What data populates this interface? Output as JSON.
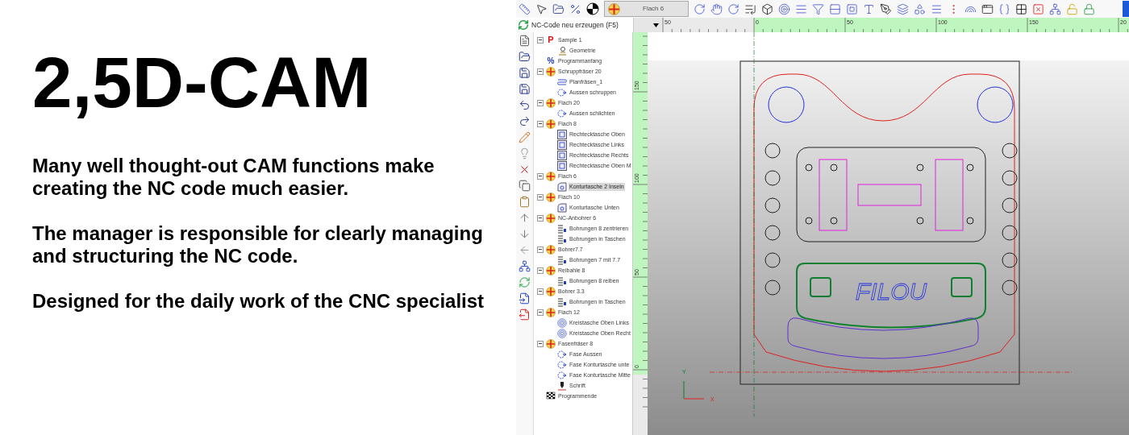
{
  "hero": {
    "title": "2,5D-CAM",
    "paragraphs": [
      "Many well thought-out CAM functions make creating the NC code much easier.",
      "The manager is responsible for clearly managing and structuring the NC code.",
      "Designed for the daily work of the CNC specialist"
    ]
  },
  "toolbar": {
    "combo": {
      "value": "Flach 6"
    }
  },
  "command": {
    "label": "NC-Code neu erzeugen (F5)"
  },
  "h_ruler": {
    "labels": [
      "50",
      "0",
      "50",
      "100",
      "150",
      "20"
    ]
  },
  "v_ruler": {
    "labels": [
      "150",
      "100",
      "50",
      "0"
    ]
  },
  "tree": [
    {
      "label": "Sample 1",
      "kind": "program",
      "glyph": "P",
      "selected": false,
      "expanded": true,
      "children": [
        {
          "label": "Geometrie",
          "kind": "geometry",
          "selected": false
        }
      ]
    },
    {
      "label": "Programmanfang",
      "kind": "start",
      "glyph": "%",
      "selected": false
    },
    {
      "label": "Schruppfräser 20",
      "kind": "tool",
      "selected": false,
      "expanded": true,
      "children": [
        {
          "label": "Planfräsen_1",
          "kind": "face",
          "selected": false
        },
        {
          "label": "Aussen schruppen",
          "kind": "contour",
          "selected": false
        }
      ]
    },
    {
      "label": "Flach 20",
      "kind": "tool",
      "selected": false,
      "expanded": true,
      "children": [
        {
          "label": "Aussen schlichten",
          "kind": "contour",
          "selected": false
        }
      ]
    },
    {
      "label": "Flach 8",
      "kind": "tool",
      "selected": false,
      "expanded": true,
      "children": [
        {
          "label": "Rechtecktasche Oben",
          "kind": "pocket",
          "selected": false
        },
        {
          "label": "Rechtecktasche Links",
          "kind": "pocket",
          "selected": false
        },
        {
          "label": "Rechtecktasche Rechts",
          "kind": "pocket",
          "selected": false
        },
        {
          "label": "Rechtecktasche Oben M",
          "kind": "pocket",
          "selected": false
        }
      ]
    },
    {
      "label": "Flach 6",
      "kind": "tool",
      "selected": false,
      "expanded": true,
      "children": [
        {
          "label": "Konturtasche 2 Inseln",
          "kind": "island",
          "selected": true
        }
      ]
    },
    {
      "label": "Flach 10",
      "kind": "tool",
      "selected": false,
      "expanded": true,
      "children": [
        {
          "label": "Konturtasche Unten",
          "kind": "island",
          "selected": false
        }
      ]
    },
    {
      "label": "NC-Anbohrer 6",
      "kind": "tool",
      "selected": false,
      "expanded": true,
      "children": [
        {
          "label": "Bohrungen 8 zentrieren",
          "kind": "drill",
          "selected": false
        },
        {
          "label": "Bohrungen in Taschen",
          "kind": "drill",
          "selected": false
        }
      ]
    },
    {
      "label": "Bohrer7.7",
      "kind": "tool",
      "selected": false,
      "expanded": true,
      "children": [
        {
          "label": "Bohrungen 7 mit 7.7",
          "kind": "drill",
          "selected": false
        }
      ]
    },
    {
      "label": "Reibahle 8",
      "kind": "tool",
      "selected": false,
      "expanded": true,
      "children": [
        {
          "label": "Bohrungen 8 reiben",
          "kind": "drill",
          "selected": false
        }
      ]
    },
    {
      "label": "Bohrer 3.3",
      "kind": "tool",
      "selected": false,
      "expanded": true,
      "children": [
        {
          "label": "Bohrungen in Taschen",
          "kind": "drill",
          "selected": false
        }
      ]
    },
    {
      "label": "Flach 12",
      "kind": "tool",
      "selected": false,
      "expanded": true,
      "children": [
        {
          "label": "Kreistasche Oben Links",
          "kind": "circle",
          "selected": false
        },
        {
          "label": "Kreistasche Oben Recht",
          "kind": "circle",
          "selected": false
        }
      ]
    },
    {
      "label": "Fasenfräser 8",
      "kind": "tool",
      "selected": false,
      "expanded": true,
      "children": [
        {
          "label": "Fase Aussen",
          "kind": "contour",
          "selected": false
        },
        {
          "label": "Fase Konturtasche unte",
          "kind": "contour",
          "selected": false
        },
        {
          "label": "Fase Konturtasche Mitte",
          "kind": "contour",
          "selected": false
        },
        {
          "label": "Schrift",
          "kind": "text",
          "selected": false
        }
      ]
    },
    {
      "label": "Programmende",
      "kind": "end",
      "selected": false
    }
  ],
  "canvas": {
    "engraving": "FILOU",
    "axis_y": "Y",
    "axis_x": "X"
  }
}
